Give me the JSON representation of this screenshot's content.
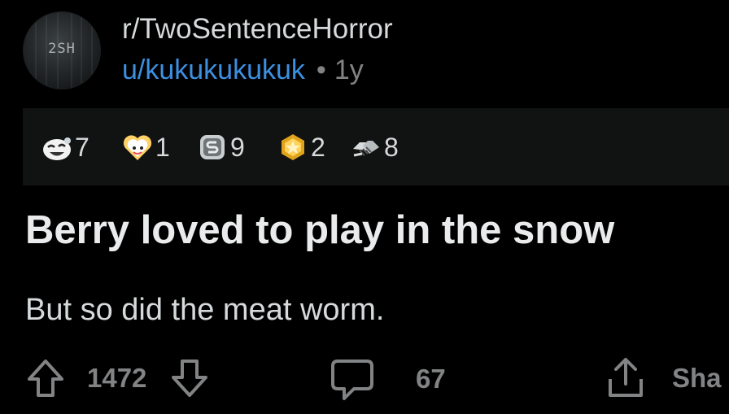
{
  "post": {
    "subreddit": "r/TwoSentenceHorror",
    "subreddit_avatar_text": "2SH",
    "author": "u/kukukukukuk",
    "separator": "•",
    "age": "1y",
    "title": "Berry loved to play in the snow",
    "body": "But so did the meat worm."
  },
  "awards": [
    {
      "icon": "laughing-face-award-icon",
      "count": "7"
    },
    {
      "icon": "wholesome-heart-award-icon",
      "count": "1"
    },
    {
      "icon": "silver-award-icon",
      "count": "9"
    },
    {
      "icon": "gold-award-icon",
      "count": "2"
    },
    {
      "icon": "handshake-award-icon",
      "count": "8"
    }
  ],
  "actions": {
    "upvotes": "1472",
    "comments": "67",
    "share_label": "Sha"
  },
  "colors": {
    "background": "#000000",
    "author_link": "#3d8fe0",
    "muted": "#818384",
    "text": "#d7dadc",
    "awards_bar": "#111212"
  }
}
